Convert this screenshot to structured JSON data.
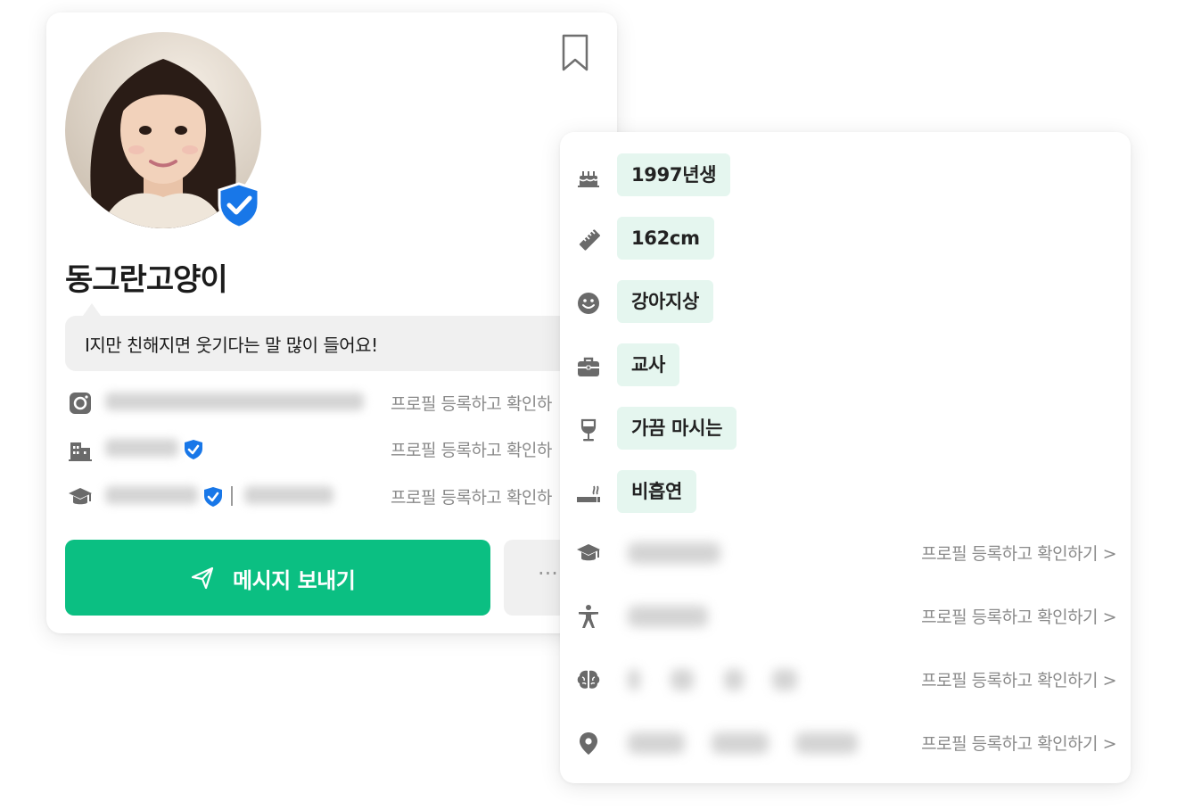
{
  "profile": {
    "nickname": "동그란고양이",
    "intro": "I지만 친해지면 웃기다는 말 많이 들어요!",
    "info_rows": [
      {
        "icon": "instagram-icon",
        "link": "프로필 등록하고 확인하"
      },
      {
        "icon": "building-icon",
        "link": "프로필 등록하고 확인하"
      },
      {
        "icon": "graduation-cap-icon",
        "link": "프로필 등록하고 확인하"
      }
    ],
    "send_button": "메시지 보내기",
    "more_button": "···",
    "colors": {
      "accent": "#0bbf82",
      "verified": "#1877e8"
    }
  },
  "details": {
    "items": [
      {
        "icon": "birthday-cake-icon",
        "value": "1997년생"
      },
      {
        "icon": "ruler-icon",
        "value": "162cm"
      },
      {
        "icon": "smile-icon",
        "value": "강아지상"
      },
      {
        "icon": "briefcase-icon",
        "value": "교사"
      },
      {
        "icon": "wine-glass-icon",
        "value": "가끔 마시는"
      },
      {
        "icon": "cigarette-icon",
        "value": "비흡연"
      }
    ],
    "locked": [
      {
        "icon": "graduation-cap-icon",
        "link": "프로필 등록하고 확인하기 >"
      },
      {
        "icon": "person-icon",
        "link": "프로필 등록하고 확인하기 >"
      },
      {
        "icon": "brain-icon",
        "link": "프로필 등록하고 확인하기 >"
      },
      {
        "icon": "location-pin-icon",
        "link": "프로필 등록하고 확인하기 >"
      }
    ]
  }
}
